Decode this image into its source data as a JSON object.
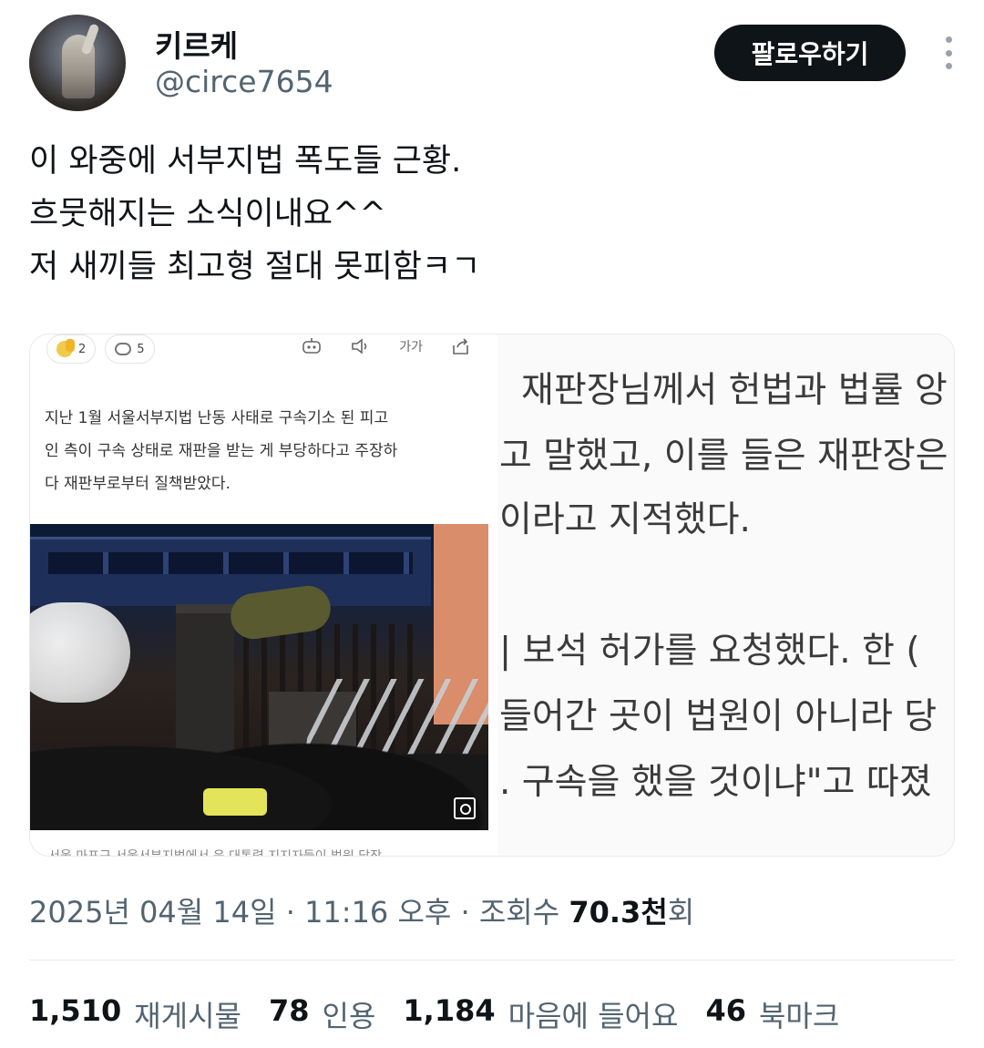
{
  "author": {
    "display_name": "키르케",
    "handle": "@circe7654",
    "avatar_icon": "avatar-image"
  },
  "actions": {
    "follow_label": "팔로우하기",
    "more_icon": "more-vertical-icon"
  },
  "tweet": {
    "lines": [
      "이 와중에 서부지법 폭도들 근황.",
      "흐뭇해지는 소식이내요^^",
      "저 새끼들 최고형 절대 못피함ㅋㄱ"
    ]
  },
  "media_left": {
    "reactions": [
      {
        "icon": "reaction-emoji-icon",
        "count": "2"
      },
      {
        "icon": "comment-icon",
        "count": "5"
      }
    ],
    "tools": {
      "font_size_label": "가가",
      "icons": [
        "robot-icon",
        "speaker-icon",
        "share-icon"
      ]
    },
    "article_lines": [
      "지난 1월 서울서부지법 난동 사태로 구속기소 된 피고",
      "인 측이 구속 상태로 재판을 받는 게 부당하다고 주장하",
      "다 재판부로부터 질책받았다."
    ],
    "caption": "서울 마포구 서울서부지법에서 윤 대통령 지지자들이 법원 담장",
    "zoom_icon": "zoom-icon"
  },
  "media_right": {
    "lines": [
      "재판장님께서 헌법과 법률 앙",
      "고 말했고, 이를 들은 재판장은",
      "이라고 지적했다.",
      "| 보석 허가를 요청했다. 한 (",
      "들어간 곳이 법원이 아니라 당",
      ". 구속을 했을 것이냐\"고 따졌"
    ]
  },
  "meta": {
    "date": "2025년 04월 14일",
    "separator": "·",
    "time": "11:16 오후",
    "views_label": "조회수",
    "views_value": "70.3천",
    "views_suffix": "회"
  },
  "stats": [
    {
      "value": "1,510",
      "label": "재게시물"
    },
    {
      "value": "78",
      "label": "인용"
    },
    {
      "value": "1,184",
      "label": "마음에 들어요"
    },
    {
      "value": "46",
      "label": "북마크"
    }
  ]
}
